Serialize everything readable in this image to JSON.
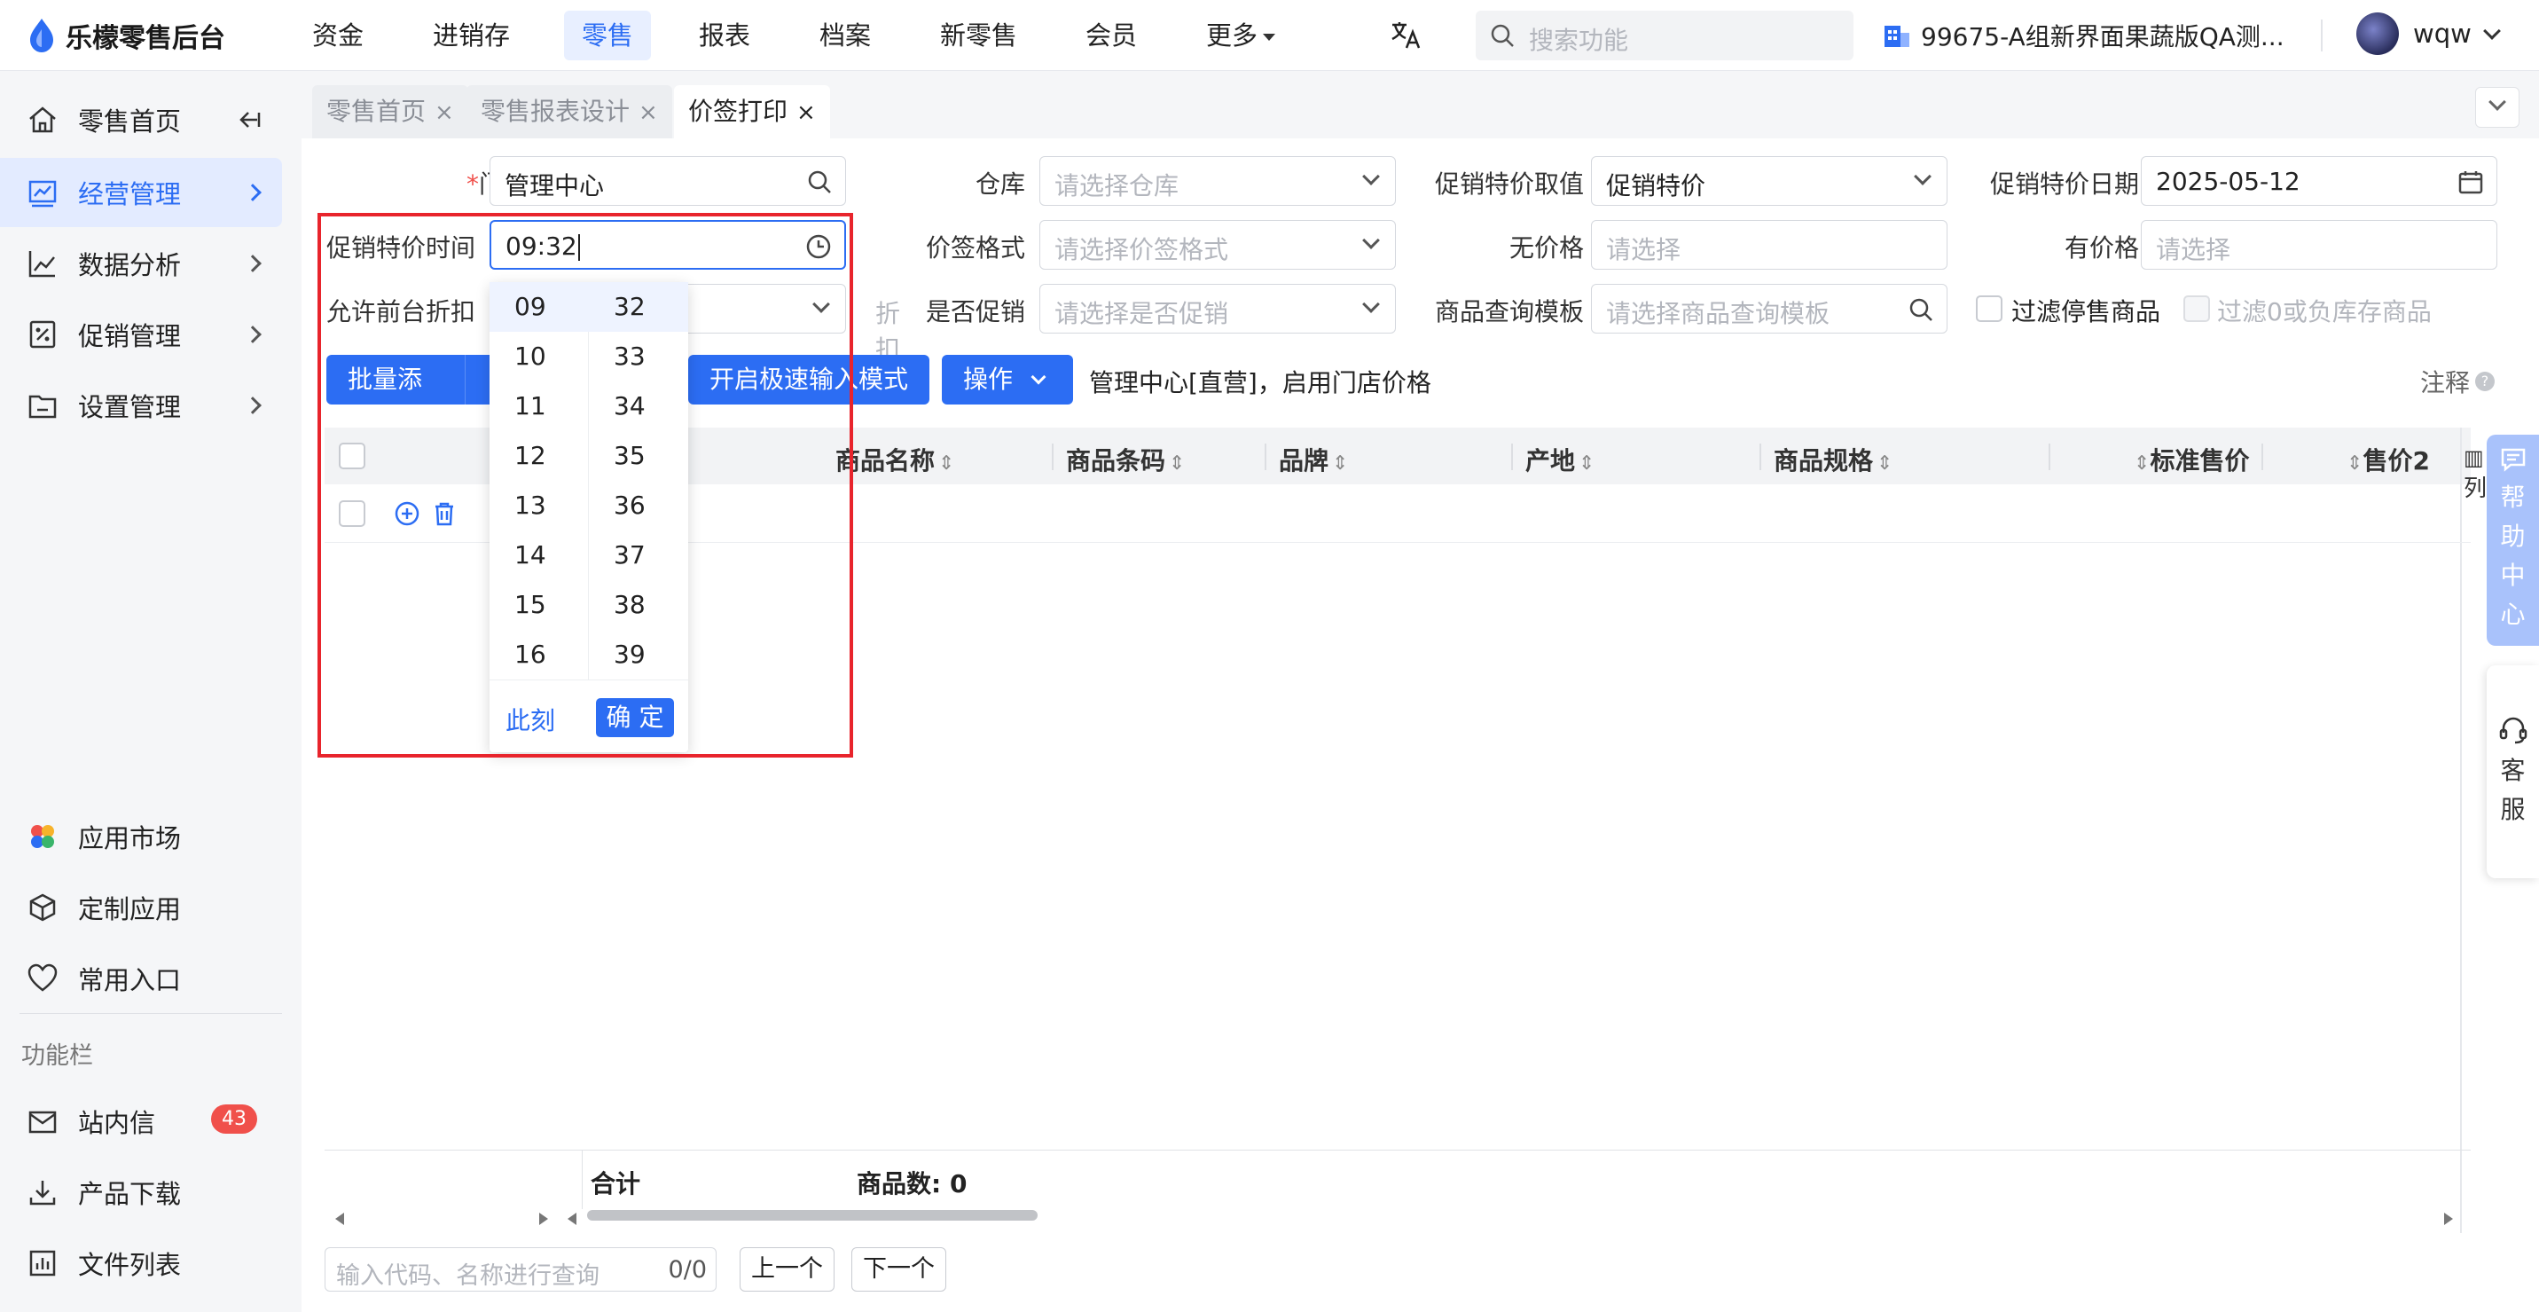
{
  "app": {
    "logo_text": "乐檬零售后台"
  },
  "nav": {
    "items": [
      {
        "label": "资金"
      },
      {
        "label": "进销存"
      },
      {
        "label": "零售"
      },
      {
        "label": "报表"
      },
      {
        "label": "档案"
      },
      {
        "label": "新零售"
      },
      {
        "label": "会员"
      },
      {
        "label": "更多"
      }
    ],
    "active_index": 2,
    "search_placeholder": "搜索功能",
    "org_name": "99675-A组新界面果蔬版QA测...",
    "user_name": "wqw"
  },
  "sidebar": {
    "items": [
      {
        "label": "零售首页"
      },
      {
        "label": "经营管理"
      },
      {
        "label": "数据分析"
      },
      {
        "label": "促销管理"
      },
      {
        "label": "设置管理"
      }
    ],
    "bottom_items": [
      {
        "label": "应用市场"
      },
      {
        "label": "定制应用"
      },
      {
        "label": "常用入口"
      }
    ],
    "section_title": "功能栏",
    "func_items": [
      {
        "label": "站内信",
        "badge": "43"
      },
      {
        "label": "产品下载"
      },
      {
        "label": "文件列表"
      }
    ]
  },
  "tabs": [
    {
      "label": "零售首页"
    },
    {
      "label": "零售报表设计"
    },
    {
      "label": "价签打印"
    }
  ],
  "form": {
    "store": {
      "label": "门店",
      "required_mark": "*",
      "value": "管理中心"
    },
    "warehouse": {
      "label": "仓库",
      "placeholder": "请选择仓库"
    },
    "promo_value": {
      "label": "促销特价取值",
      "value": "促销特价"
    },
    "promo_date": {
      "label": "促销特价日期",
      "value": "2025-05-12"
    },
    "promo_time": {
      "label": "促销特价时间",
      "value": "09:32"
    },
    "tag_format": {
      "label": "价签格式",
      "placeholder": "请选择价签格式"
    },
    "no_price": {
      "label": "无价格",
      "placeholder": "请选择"
    },
    "has_price": {
      "label": "有价格",
      "placeholder": "请选择"
    },
    "allow_discount": {
      "label": "允许前台折扣",
      "placeholder_visible": "折扣"
    },
    "is_promo": {
      "label": "是否促销",
      "placeholder": "请选择是否促销"
    },
    "query_template": {
      "label": "商品查询模板",
      "placeholder": "请选择商品查询模板"
    },
    "filter_stopped": {
      "label": "过滤停售商品"
    },
    "filter_zero": {
      "label": "过滤0或负库存商品"
    }
  },
  "toolbar": {
    "batch_add": "批量添加",
    "fast_mode": "开启极速输入模式",
    "operate": "操作",
    "info": "管理中心[直营]，启用门店价格",
    "note": "注释"
  },
  "table": {
    "columns": [
      "商品名称",
      "商品条码",
      "品牌",
      "产地",
      "商品规格",
      "标准售价",
      "售价2"
    ],
    "cols_label": "列",
    "total_label": "合计",
    "count_label": "商品数: 0"
  },
  "pager": {
    "placeholder": "输入代码、名称进行查询",
    "count": "0/0",
    "prev": "上一个",
    "next": "下一个"
  },
  "time_picker": {
    "hours": [
      "09",
      "10",
      "11",
      "12",
      "13",
      "14",
      "15",
      "16"
    ],
    "minutes": [
      "32",
      "33",
      "34",
      "35",
      "36",
      "37",
      "38",
      "39"
    ],
    "now_label": "此刻",
    "ok_label": "确 定"
  },
  "floating": {
    "help_chars": [
      "帮",
      "助",
      "中",
      "心"
    ],
    "service_chars": [
      "客",
      "服"
    ]
  },
  "colors": {
    "primary": "#2c6df3",
    "highlight": "#e8242c",
    "badge": "#f0504b"
  }
}
